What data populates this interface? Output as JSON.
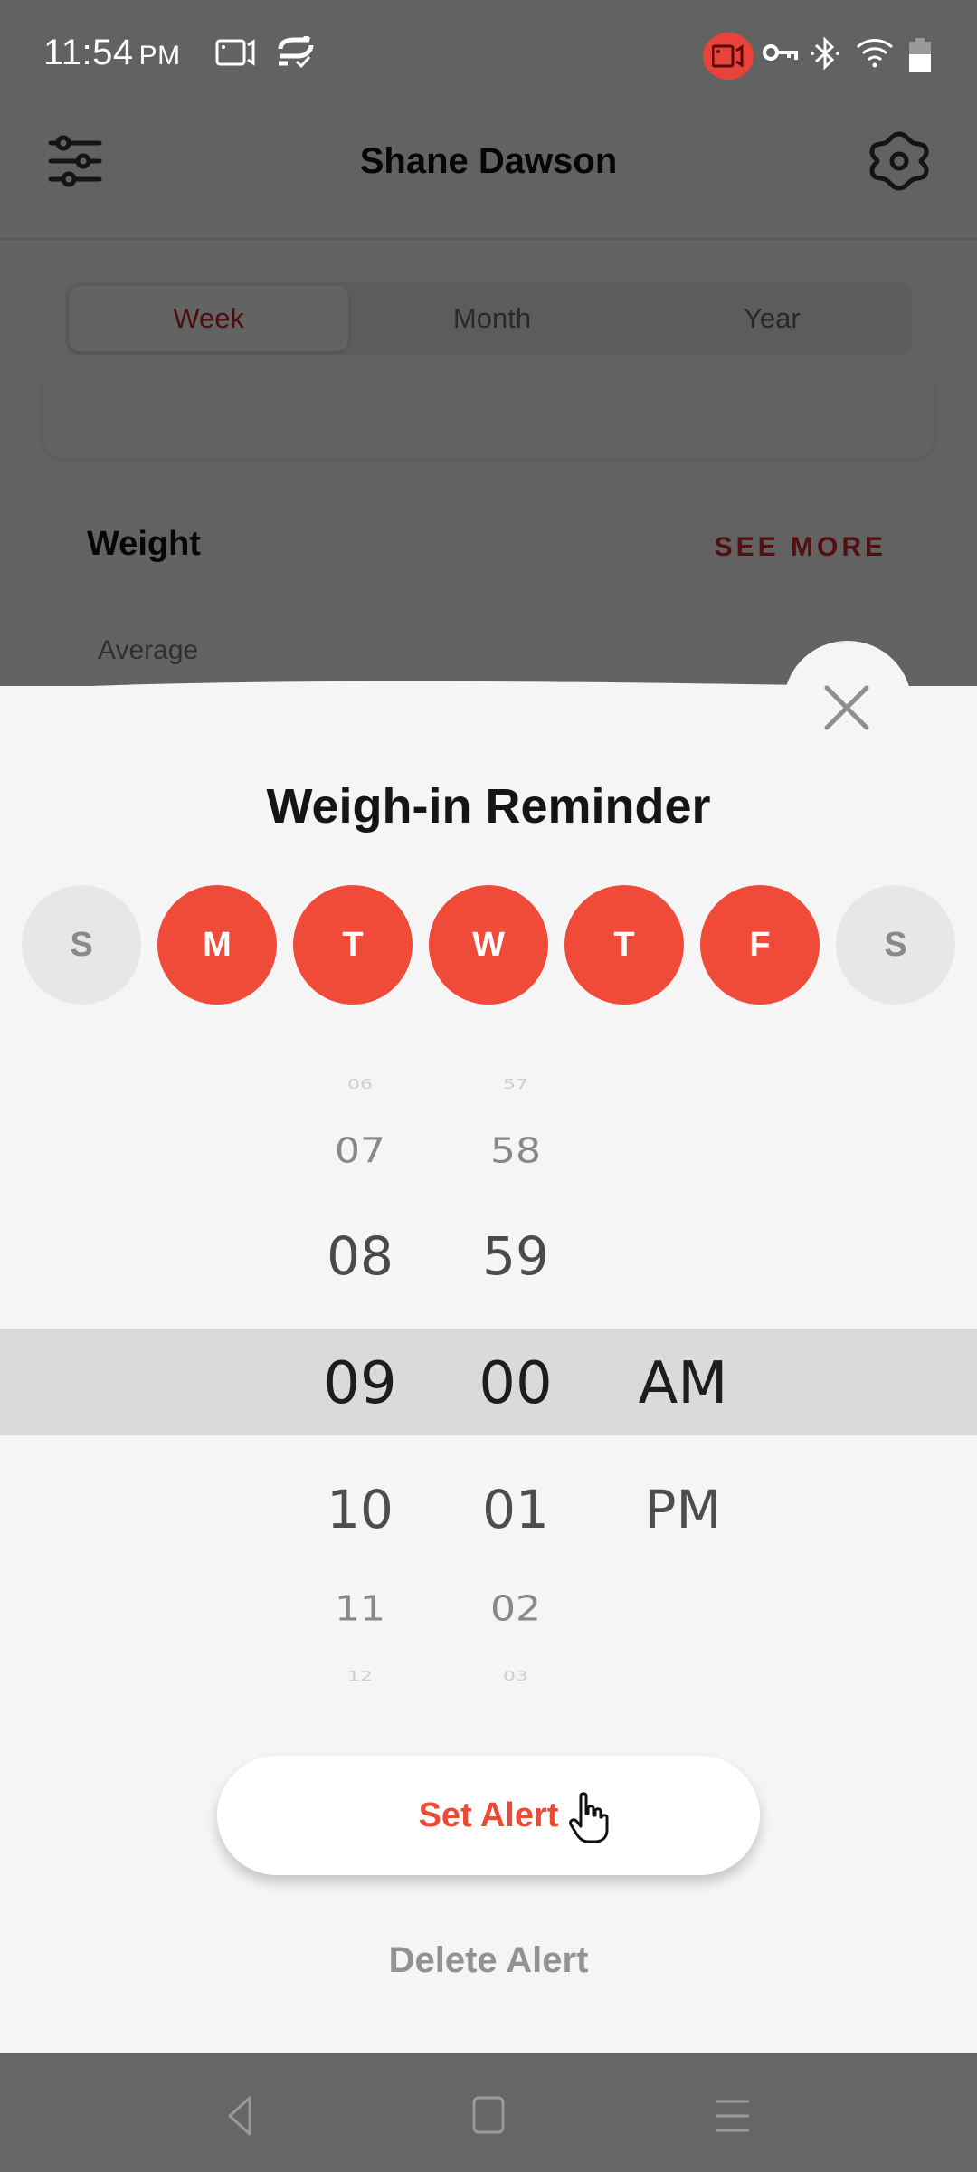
{
  "status_bar": {
    "time": "11:54",
    "ampm": "PM",
    "icons": [
      "screen-record-icon",
      "sync-check-icon",
      "recording-camera-icon",
      "vpn-key-icon",
      "bluetooth-icon",
      "wifi-icon",
      "battery-icon"
    ]
  },
  "app_bar": {
    "title": "Shane Dawson",
    "left_icon": "filter-sliders-icon",
    "right_icon": "settings-gear-icon"
  },
  "period_tabs": [
    {
      "label": "Week",
      "active": true
    },
    {
      "label": "Month",
      "active": false
    },
    {
      "label": "Year",
      "active": false
    }
  ],
  "weight_section": {
    "title": "Weight",
    "see_more": "SEE MORE",
    "average_label": "Average"
  },
  "reminder_sheet": {
    "title": "Weigh-in Reminder",
    "close_icon": "close-x-icon",
    "days": [
      {
        "label": "S",
        "name": "Sunday",
        "selected": false
      },
      {
        "label": "M",
        "name": "Monday",
        "selected": true
      },
      {
        "label": "T",
        "name": "Tuesday",
        "selected": true
      },
      {
        "label": "W",
        "name": "Wednesday",
        "selected": true
      },
      {
        "label": "T",
        "name": "Thursday",
        "selected": true
      },
      {
        "label": "F",
        "name": "Friday",
        "selected": true
      },
      {
        "label": "S",
        "name": "Saturday",
        "selected": false
      }
    ],
    "time_picker": {
      "hours": [
        "06",
        "07",
        "08",
        "09",
        "10",
        "11",
        "12"
      ],
      "minutes": [
        "57",
        "58",
        "59",
        "00",
        "01",
        "02",
        "03"
      ],
      "periods": [
        "AM",
        "PM"
      ],
      "selected": {
        "hour": "09",
        "minute": "00",
        "period": "AM"
      }
    },
    "set_alert": "Set Alert",
    "delete_alert": "Delete Alert"
  },
  "colors": {
    "accent": "#f04a38",
    "accent_text": "#ec4a37",
    "dark_red": "#d0262d",
    "unselected_day": "#e8e7e8",
    "sheet_bg": "#f6f5f6",
    "picker_band": "#dbdadb",
    "overlay_nav": "#666666"
  },
  "nav_bar": {
    "icons": [
      "back-icon",
      "home-icon",
      "recents-menu-icon"
    ]
  }
}
